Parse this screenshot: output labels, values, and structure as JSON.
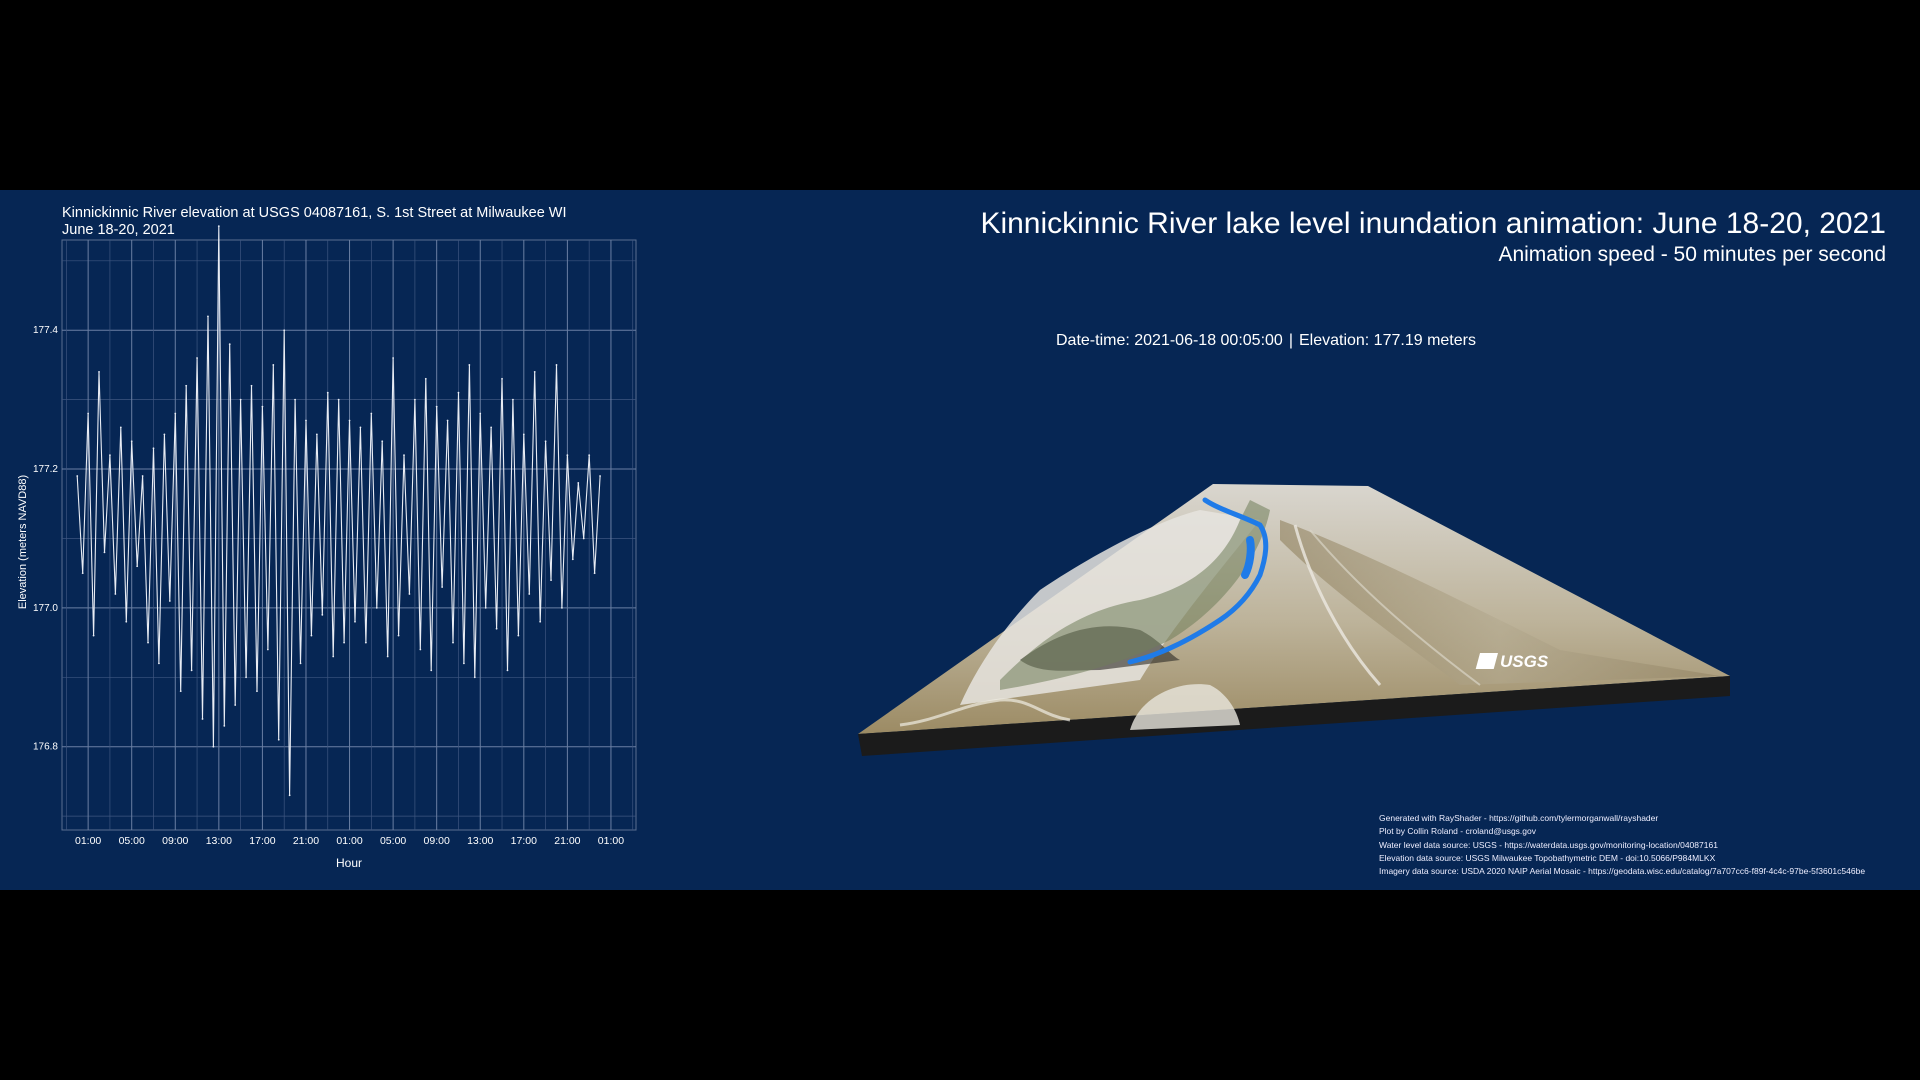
{
  "header": {
    "title": "Kinnickinnic River lake level inundation animation: June 18-20, 2021",
    "speed": "Animation speed - 50 minutes per second"
  },
  "status": {
    "datetime": "Date-time: 2021-06-18 00:05:00",
    "separator": "|",
    "elevation": "Elevation: 177.19 meters"
  },
  "logo": {
    "text": "USGS"
  },
  "credits": [
    "Generated with RayShader - https://github.com/tylermorganwall/rayshader",
    "Plot by Collin Roland - croland@usgs.gov",
    "Water level data source: USGS - https://waterdata.usgs.gov/monitoring-location/04087161",
    "Elevation data source: USGS Milwaukee Topobathymetric DEM - doi:10.5066/P984MLKX",
    "Imagery data source: USDA 2020 NAIP Aerial Mosaic - https://geodata.wisc.edu/catalog/7a707cc6-f89f-4c4c-97be-5f3601c546be"
  ],
  "colors": {
    "panel_bg": "#062654",
    "line": "#e8ecf4",
    "water": "#1f7be8"
  },
  "chart_data": {
    "type": "line",
    "title": "Kinnickinnic River elevation at USGS 04087161, S. 1st Street at Milwaukee WI",
    "subtitle": "June 18-20, 2021",
    "xlabel": "Hour",
    "ylabel": "Elevation (meters NAVD88)",
    "xlim": [
      -1.4,
      51.3
    ],
    "ylim": [
      176.68,
      177.53
    ],
    "y_ticks": [
      176.8,
      177.0,
      177.2,
      177.4
    ],
    "x_ticks": [
      {
        "value": 1,
        "label": "01:00"
      },
      {
        "value": 5,
        "label": "05:00"
      },
      {
        "value": 9,
        "label": "09:00"
      },
      {
        "value": 13,
        "label": "13:00"
      },
      {
        "value": 17,
        "label": "17:00"
      },
      {
        "value": 21,
        "label": "21:00"
      },
      {
        "value": 25,
        "label": "01:00"
      },
      {
        "value": 29,
        "label": "05:00"
      },
      {
        "value": 33,
        "label": "09:00"
      },
      {
        "value": 37,
        "label": "13:00"
      },
      {
        "value": 41,
        "label": "17:00"
      },
      {
        "value": 45,
        "label": "21:00"
      },
      {
        "value": 49,
        "label": "01:00"
      }
    ],
    "grid": true,
    "legend": "none",
    "series": [
      {
        "x": [
          0.0,
          0.5,
          1.0,
          1.5,
          2.0,
          2.5,
          3.0,
          3.5,
          4.0,
          4.5,
          5.0,
          5.5,
          6.0,
          6.5,
          7.0,
          7.5,
          8.0,
          8.5,
          9.0,
          9.5,
          10.0,
          10.5,
          11.0,
          11.5,
          12.0,
          12.5,
          13.0,
          13.5,
          14.0,
          14.5,
          15.0,
          15.5,
          16.0,
          16.5,
          17.0,
          17.5,
          18.0,
          18.5,
          19.0,
          19.5,
          20.0,
          20.5,
          21.0,
          21.5,
          22.0,
          22.5,
          23.0,
          23.5,
          24.0,
          24.5,
          25.0,
          25.5,
          26.0,
          26.5,
          27.0,
          27.5,
          28.0,
          28.5,
          29.0,
          29.5,
          30.0,
          30.5,
          31.0,
          31.5,
          32.0,
          32.5,
          33.0,
          33.5,
          34.0,
          34.5,
          35.0,
          35.5,
          36.0,
          36.5,
          37.0,
          37.5,
          38.0,
          38.5,
          39.0,
          39.5,
          40.0,
          40.5,
          41.0,
          41.5,
          42.0,
          42.5,
          43.0,
          43.5,
          44.0,
          44.5,
          45.0,
          45.5,
          46.0,
          46.5,
          47.0,
          47.5,
          48.0
        ],
        "y": [
          177.19,
          177.05,
          177.28,
          176.96,
          177.34,
          177.08,
          177.22,
          177.02,
          177.26,
          176.98,
          177.24,
          177.06,
          177.19,
          176.95,
          177.23,
          176.92,
          177.25,
          177.01,
          177.28,
          176.88,
          177.32,
          176.91,
          177.36,
          176.84,
          177.42,
          176.8,
          177.55,
          176.83,
          177.38,
          176.86,
          177.3,
          176.9,
          177.32,
          176.88,
          177.29,
          176.94,
          177.35,
          176.81,
          177.4,
          176.73,
          177.3,
          176.92,
          177.27,
          176.96,
          177.25,
          176.99,
          177.31,
          176.93,
          177.3,
          176.95,
          177.27,
          176.98,
          177.26,
          176.95,
          177.28,
          177.0,
          177.24,
          176.93,
          177.36,
          176.96,
          177.22,
          177.02,
          177.3,
          176.94,
          177.33,
          176.91,
          177.29,
          177.03,
          177.27,
          176.95,
          177.31,
          176.92,
          177.35,
          176.9,
          177.28,
          177.0,
          177.26,
          176.97,
          177.33,
          176.91,
          177.3,
          176.96,
          177.25,
          177.02,
          177.34,
          176.98,
          177.24,
          177.04,
          177.35,
          177.0,
          177.22,
          177.07,
          177.18,
          177.1,
          177.22,
          177.05,
          177.19
        ]
      }
    ]
  }
}
